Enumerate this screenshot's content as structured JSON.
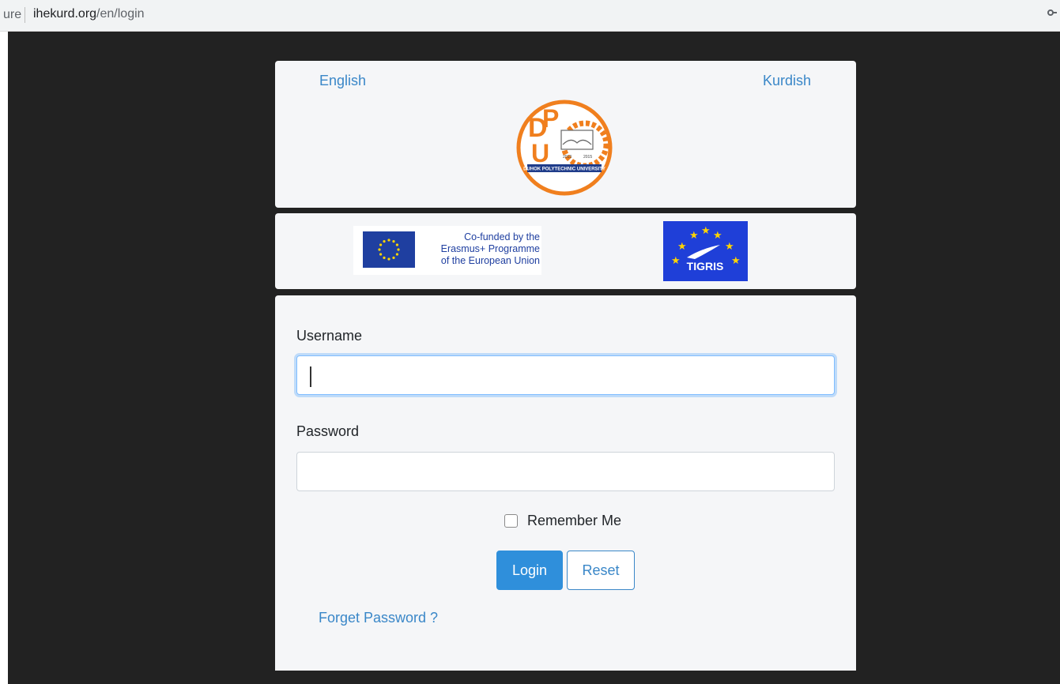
{
  "browser": {
    "security_text": "ure",
    "url_host": "ihekurd.org",
    "url_path": "/en/login",
    "key_icon": "key-icon"
  },
  "header": {
    "lang_english": "English",
    "lang_kurdish": "Kurdish",
    "logo_text": "DUHOK POLYTECHNIC UNIVERSITY",
    "logo_years": [
      "2013",
      "2015"
    ]
  },
  "sponsors": {
    "eu_text_lines": [
      "Co-funded by the",
      "Erasmus+ Programme",
      "of the European Union"
    ],
    "tigris_text": "TIGRIS"
  },
  "form": {
    "username_label": "Username",
    "username_value": "",
    "password_label": "Password",
    "password_value": "",
    "remember_label": "Remember Me",
    "remember_checked": false,
    "login_label": "Login",
    "reset_label": "Reset",
    "forget_label": "Forget Password ?"
  },
  "colors": {
    "link": "#3a87c8",
    "primary": "#2f8fdb",
    "logo_orange": "#f07f1e",
    "eu_blue": "#1f3fa0",
    "background": "#222222"
  }
}
